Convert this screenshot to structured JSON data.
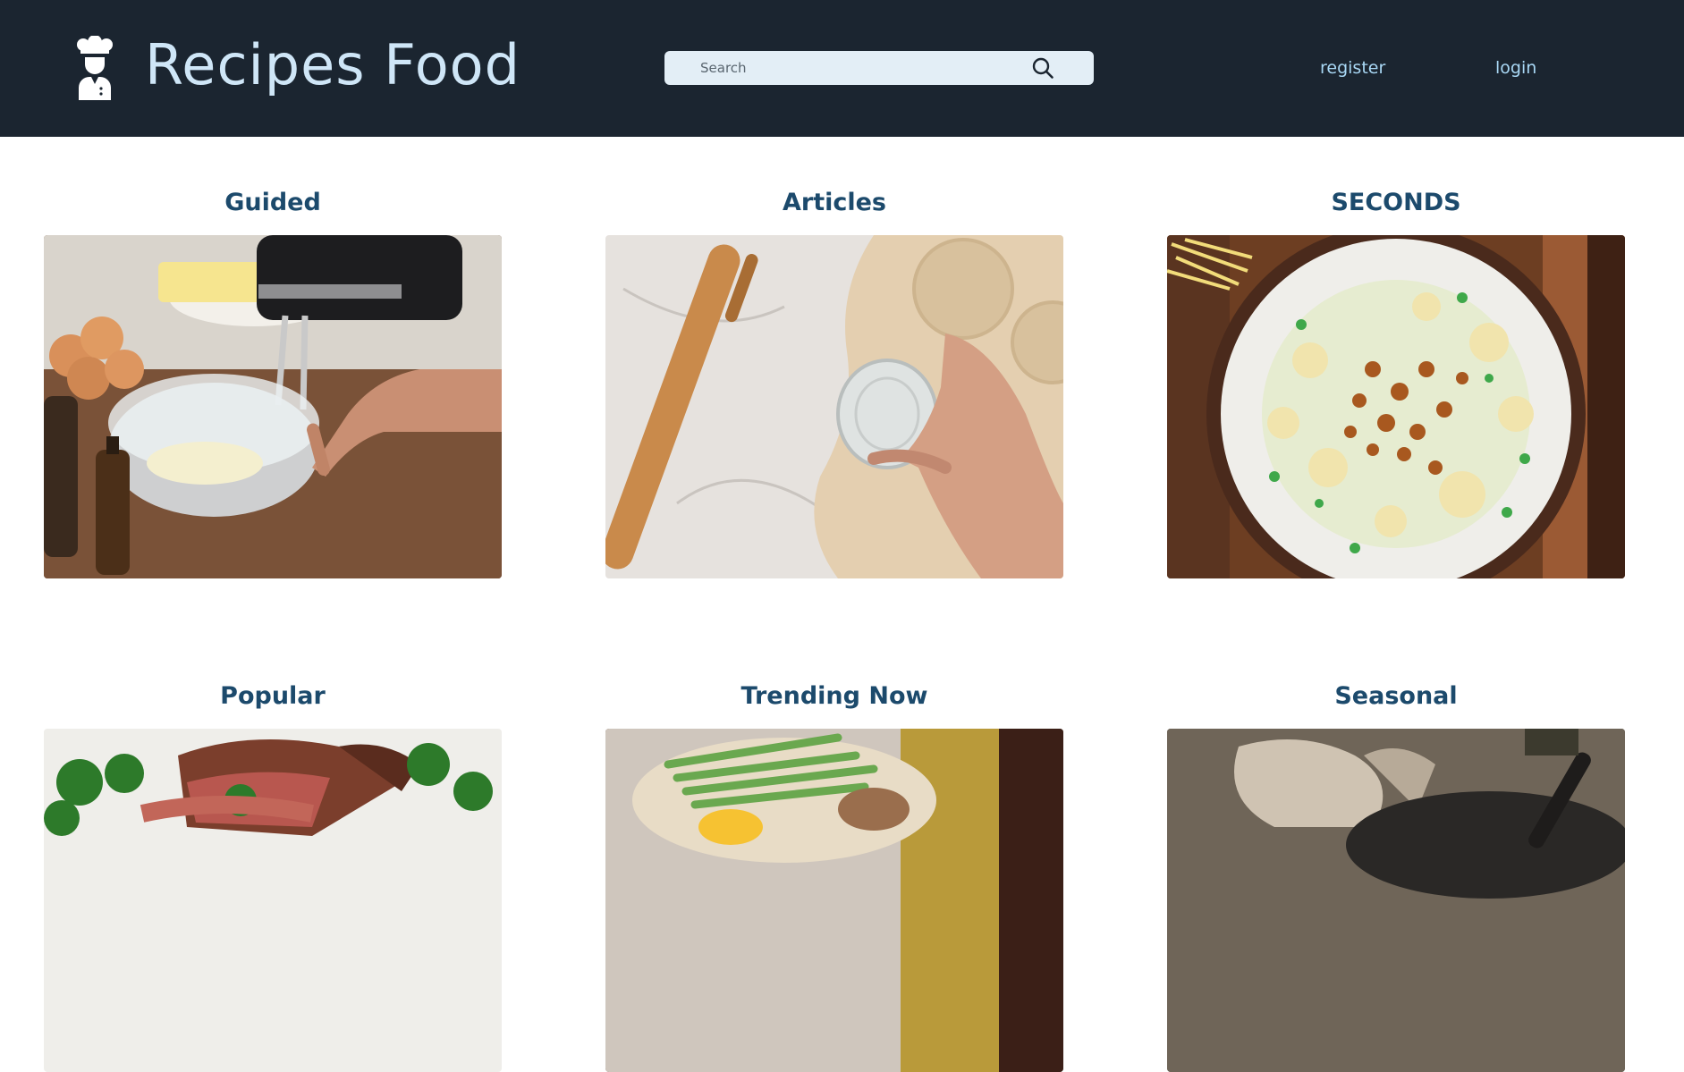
{
  "header": {
    "brand": "Recipes Food",
    "logo_icon": "chef-icon",
    "search": {
      "placeholder": "Search",
      "value": "",
      "icon": "search-icon"
    },
    "nav": {
      "register": "register",
      "login": "login"
    }
  },
  "cards": [
    {
      "title": "Guided",
      "image": "hands-whisking-butter-in-glass-bowl"
    },
    {
      "title": "Articles",
      "image": "rolling-pin-and-glass-cutting-dough"
    },
    {
      "title": "SECONDS",
      "image": "roasted-cauliflower-plate"
    },
    {
      "title": "Popular",
      "image": "roast-beef-with-broccoli"
    },
    {
      "title": "Trending Now",
      "image": "asparagus-and-egg-dish"
    },
    {
      "title": "Seasonal",
      "image": "pan-with-mushrooms"
    }
  ],
  "colors": {
    "header_bg": "#1b2530",
    "brand": "#cfe6f7",
    "nav": "#a9d8f5",
    "title": "#1c4a6c",
    "search_bg": "#e3eef6"
  }
}
